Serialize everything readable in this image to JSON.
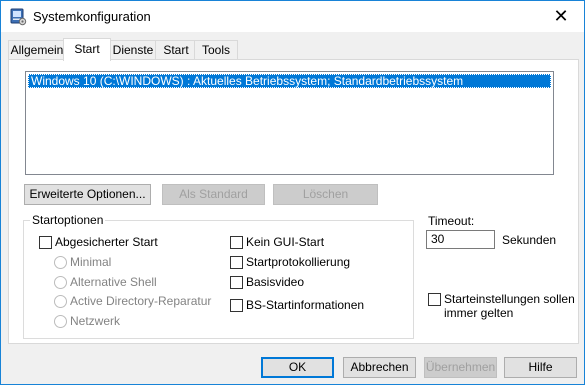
{
  "window": {
    "title": "Systemkonfiguration",
    "close_glyph": "✕"
  },
  "tabs": [
    {
      "label": "Allgemein"
    },
    {
      "label": "Start"
    },
    {
      "label": "Dienste"
    },
    {
      "label": "Start"
    },
    {
      "label": "Tools"
    }
  ],
  "active_tab": 1,
  "boot_list": {
    "items": [
      {
        "label": "Windows 10 (C:\\WINDOWS) : Aktuelles Betriebssystem; Standardbetriebssystem",
        "selected": true
      }
    ]
  },
  "boot_buttons": {
    "advanced": "Erweiterte Optionen...",
    "set_default": "Als Standard",
    "delete": "Löschen"
  },
  "boot_options": {
    "legend": "Startoptionen",
    "safe_boot": {
      "label": "Abgesicherter Start",
      "checked": false
    },
    "radios": [
      {
        "label": "Minimal"
      },
      {
        "label": "Alternative Shell"
      },
      {
        "label": "Active Directory-Reparatur"
      },
      {
        "label": "Netzwerk"
      }
    ],
    "right_checks": [
      {
        "label": "Kein GUI-Start",
        "checked": false
      },
      {
        "label": "Startprotokollierung",
        "checked": false
      },
      {
        "label": "Basisvideo",
        "checked": false
      },
      {
        "label": "BS-Startinformationen",
        "checked": false
      }
    ]
  },
  "timeout": {
    "label": "Timeout:",
    "value": "30",
    "unit": "Sekunden"
  },
  "persist": {
    "line1": "Starteinstellungen sollen",
    "line2": "immer gelten",
    "checked": false
  },
  "dialog_buttons": {
    "ok": "OK",
    "cancel": "Abbrechen",
    "apply": "Übernehmen",
    "help": "Hilfe"
  },
  "colors": {
    "accent": "#0078d7",
    "window_border": "#1883d7",
    "dialog_bg": "#f0f0f0"
  }
}
